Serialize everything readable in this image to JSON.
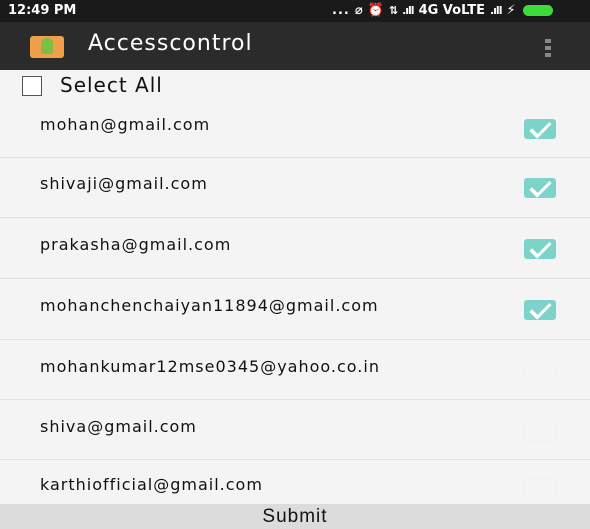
{
  "status_bar": {
    "time": "12:49 PM",
    "dots": "...",
    "network": "4G VoLTE",
    "icons": [
      "signal-off-icon",
      "alarm-icon",
      "data-arrows-icon",
      "signal-icon",
      "signal-icon-2",
      "charging-icon",
      "battery-icon"
    ],
    "battery_color": "#3ddc3d"
  },
  "app_bar": {
    "title": "Accesscontrol",
    "background": "#2b2b2b",
    "menu_icon": "overflow-menu-icon"
  },
  "select_all": {
    "label": "Select All",
    "checked": false
  },
  "contacts": [
    {
      "email": "mohan@gmail.com",
      "checked": true
    },
    {
      "email": "shivaji@gmail.com",
      "checked": true
    },
    {
      "email": "prakasha@gmail.com",
      "checked": true
    },
    {
      "email": "mohanchenchaiyan11894@gmail.com",
      "checked": true
    },
    {
      "email": "mohankumar12mse0345@yahoo.co.in",
      "checked": false
    },
    {
      "email": "shiva@gmail.com",
      "checked": false
    },
    {
      "email": "karthiofficial@gmail.com",
      "checked": false
    }
  ],
  "submit": {
    "label": "Submit"
  },
  "colors": {
    "check_accent": "#7dd3c9",
    "page_background": "#f4f4f4"
  }
}
